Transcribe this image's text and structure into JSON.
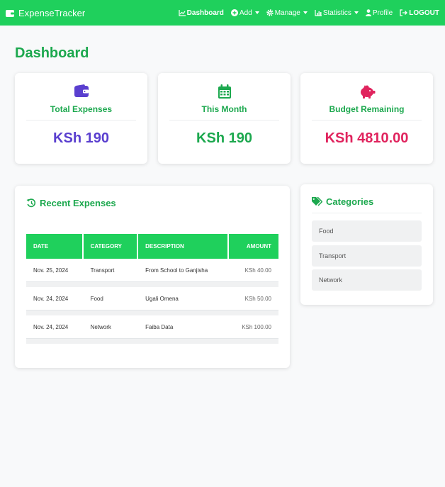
{
  "colors": {
    "navbar": "#1fd05c",
    "accent": "#1ca84e",
    "total": "#5a3fcf",
    "month": "#1ca84e",
    "budget": "#e0245e"
  },
  "navbar": {
    "brand": "ExpenseTracker",
    "items": [
      {
        "label": "Dashboard",
        "icon": "chart-line-icon"
      },
      {
        "label": "Add",
        "icon": "plus-circle-icon"
      },
      {
        "label": "Manage",
        "icon": "gear-icon"
      },
      {
        "label": "Statistics",
        "icon": "bar-chart-icon"
      },
      {
        "label": "Profile",
        "icon": "user-icon"
      },
      {
        "label": "LOGOUT",
        "icon": "sign-out-icon"
      }
    ]
  },
  "page_title": "Dashboard",
  "stats": [
    {
      "label": "Total Expenses",
      "value": "KSh 190",
      "icon": "wallet-icon"
    },
    {
      "label": "This Month",
      "value": "KSh 190",
      "icon": "calendar-icon"
    },
    {
      "label": "Budget Remaining",
      "value": "KSh 4810.00",
      "icon": "piggy-bank-icon"
    }
  ],
  "recent": {
    "title": "Recent Expenses",
    "columns": [
      "DATE",
      "CATEGORY",
      "DESCRIPTION",
      "AMOUNT"
    ],
    "rows": [
      {
        "date": "Nov. 25, 2024",
        "category": "Transport",
        "description": "From School to Ganjisha",
        "amount": "KSh 40.00"
      },
      {
        "date": "Nov. 24, 2024",
        "category": "Food",
        "description": "Ugali Omena",
        "amount": "KSh 50.00"
      },
      {
        "date": "Nov. 24, 2024",
        "category": "Network",
        "description": "Faiba Data",
        "amount": "KSh 100.00"
      }
    ]
  },
  "categories": {
    "title": "Categories",
    "items": [
      "Food",
      "Transport",
      "Network"
    ]
  }
}
